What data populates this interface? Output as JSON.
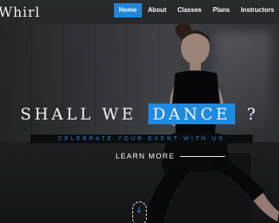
{
  "brand": {
    "name": "Whirl"
  },
  "nav": {
    "items": [
      {
        "label": "Home",
        "active": true
      },
      {
        "label": "About",
        "active": false
      },
      {
        "label": "Classes",
        "active": false
      },
      {
        "label": "Plans",
        "active": false
      },
      {
        "label": "Instructors",
        "active": false
      }
    ]
  },
  "hero": {
    "headline_start": "SHALL WE",
    "headline_highlight": "DANCE",
    "headline_end": "?",
    "tagline": "CELEBRATE YOUR EVENT WITH US",
    "cta_label": "LEARN MORE",
    "scroll_icon": "arrow-down-icon"
  },
  "colors": {
    "accent": "#1f87d6",
    "tagline": "#2f86d8",
    "text": "#ffffff"
  }
}
